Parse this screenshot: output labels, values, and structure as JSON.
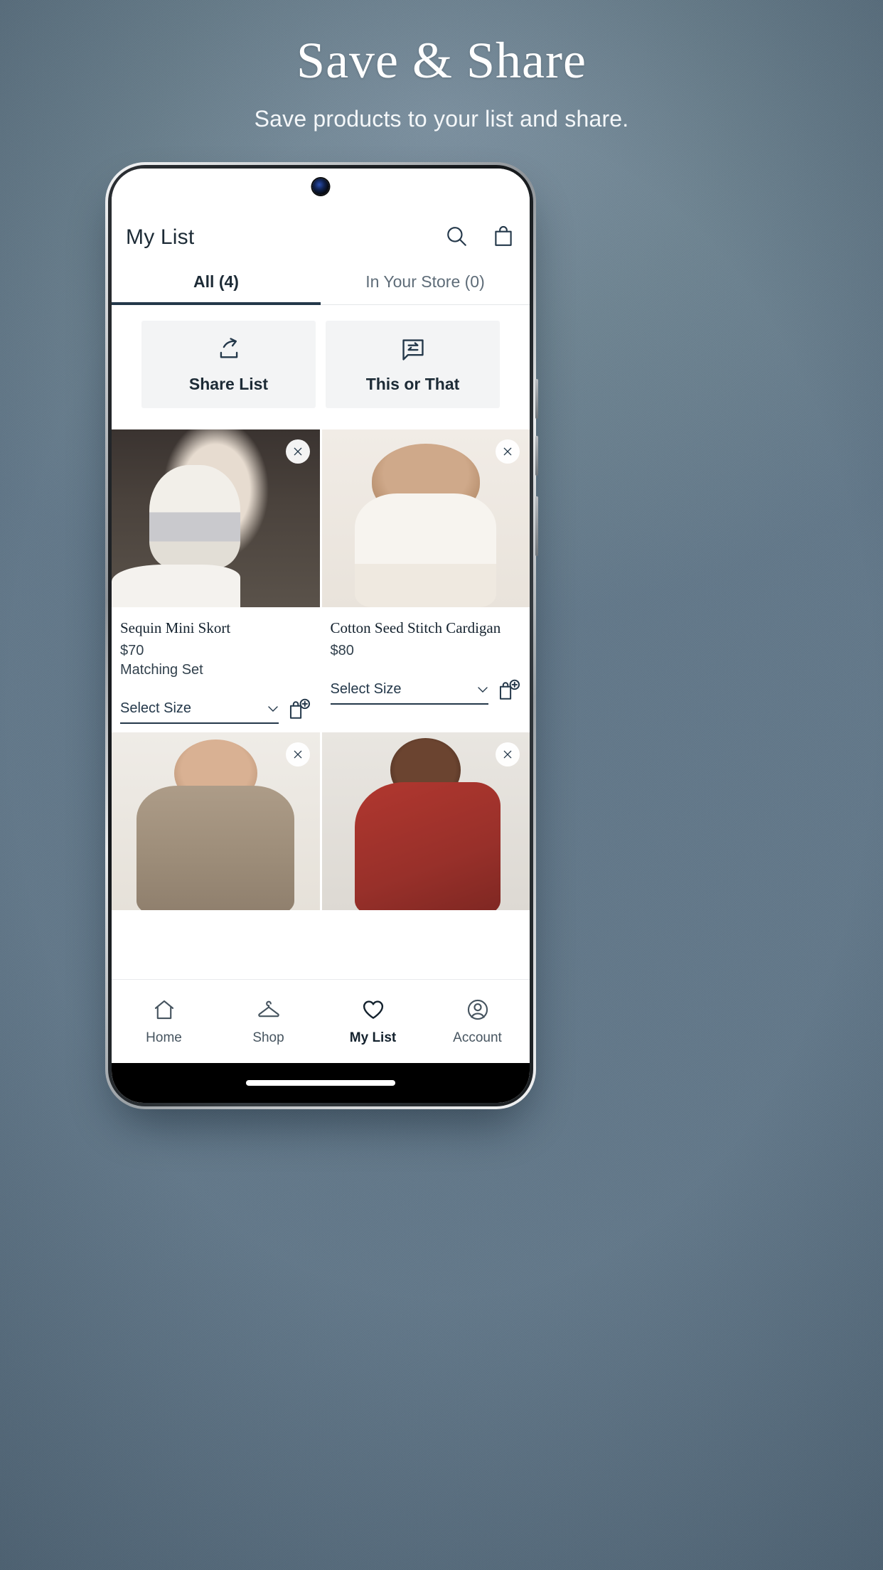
{
  "hero": {
    "title": "Save & Share",
    "subtitle": "Save products to your list and share."
  },
  "colors": {
    "background": "#6b8090",
    "accent": "#24384a",
    "text_primary": "#14222e",
    "text_secondary": "#46545f",
    "button_bg": "#f3f4f5"
  },
  "app": {
    "header": {
      "title": "My List",
      "icons": [
        {
          "name": "search-icon"
        },
        {
          "name": "shopping-bag-icon"
        }
      ]
    },
    "tabs": [
      {
        "label": "All (4)",
        "active": true
      },
      {
        "label": "In Your Store (0)",
        "active": false
      }
    ],
    "actions": [
      {
        "label": "Share List",
        "icon": "share-icon"
      },
      {
        "label": "This or That",
        "icon": "compare-chat-icon"
      }
    ],
    "products": [
      {
        "name": "Sequin Mini Skort",
        "price": "$70",
        "extra": "Matching Set",
        "size_label": "Select Size",
        "remove_icon": "close-icon",
        "add_icon": "add-to-bag-icon"
      },
      {
        "name": "Cotton Seed Stitch Cardigan",
        "price": "$80",
        "extra": "",
        "size_label": "Select Size",
        "remove_icon": "close-icon",
        "add_icon": "add-to-bag-icon"
      },
      {
        "name": "",
        "price": "",
        "extra": "",
        "size_label": "",
        "remove_icon": "close-icon",
        "add_icon": ""
      },
      {
        "name": "",
        "price": "",
        "extra": "",
        "size_label": "",
        "remove_icon": "close-icon",
        "add_icon": ""
      }
    ],
    "bottom_nav": [
      {
        "label": "Home",
        "icon": "home-icon",
        "active": false
      },
      {
        "label": "Shop",
        "icon": "hanger-icon",
        "active": false
      },
      {
        "label": "My List",
        "icon": "heart-icon",
        "active": true
      },
      {
        "label": "Account",
        "icon": "account-icon",
        "active": false
      }
    ]
  }
}
